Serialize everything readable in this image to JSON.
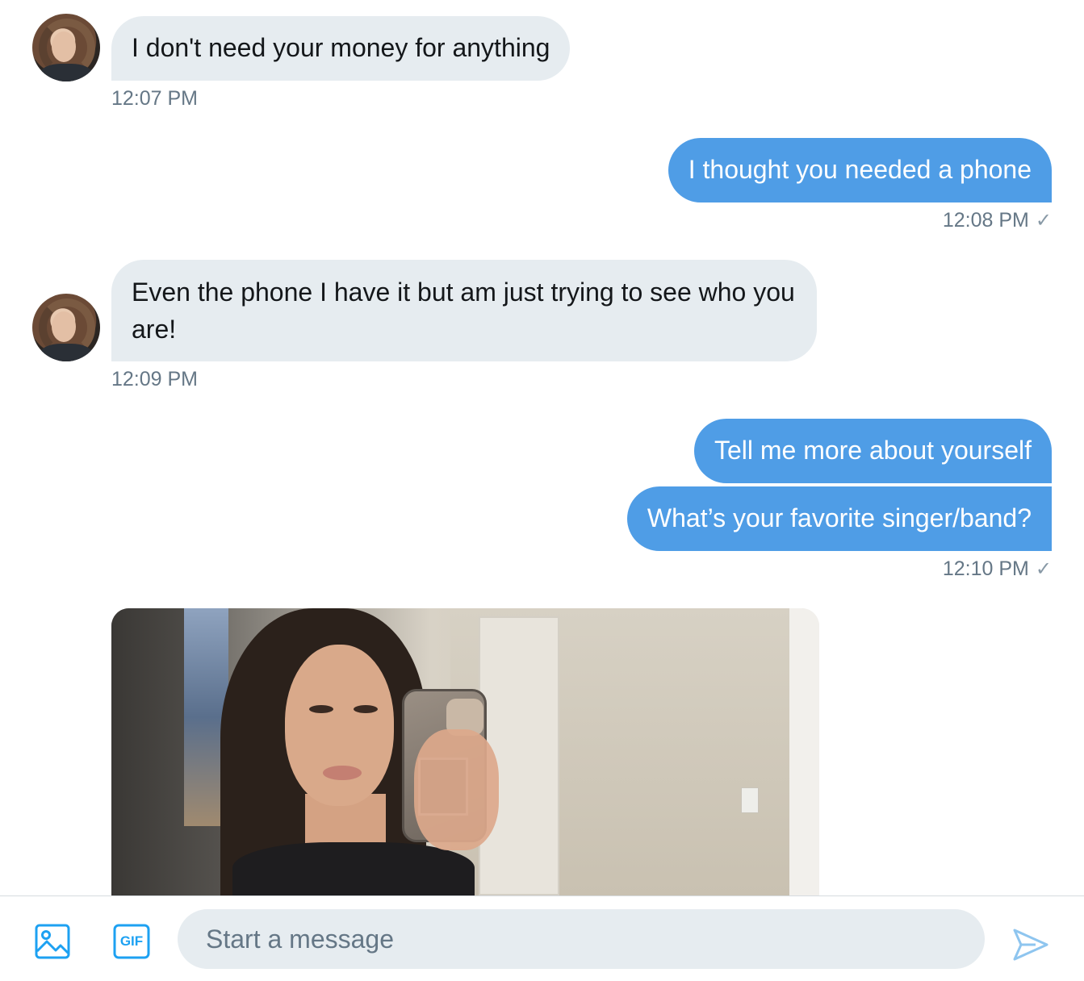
{
  "conversation": {
    "messages": [
      {
        "sender": "contact",
        "text": "I don't need your money for anything",
        "time": "12:07 PM"
      },
      {
        "sender": "me",
        "text": "I thought you needed a phone",
        "time": "12:08 PM",
        "status_icon": "check-icon"
      },
      {
        "sender": "contact",
        "text": "Even the phone I have it but am just trying to see who you are!",
        "time": "12:09 PM"
      },
      {
        "sender": "me",
        "text": "Tell me more about yourself"
      },
      {
        "sender": "me",
        "text": "What’s your favorite singer/band?",
        "time": "12:10 PM",
        "status_icon": "check-icon"
      },
      {
        "sender": "contact",
        "type": "image"
      }
    ],
    "check_glyph": "✓"
  },
  "composer": {
    "placeholder": "Start a message",
    "gif_label": "GIF",
    "icons": [
      "image-icon",
      "gif-icon",
      "send-icon"
    ]
  },
  "colors": {
    "outgoing_bubble": "#4f9de6",
    "incoming_bubble": "#e6ecf0",
    "timestamp": "#657786",
    "accent": "#1da1f2"
  }
}
